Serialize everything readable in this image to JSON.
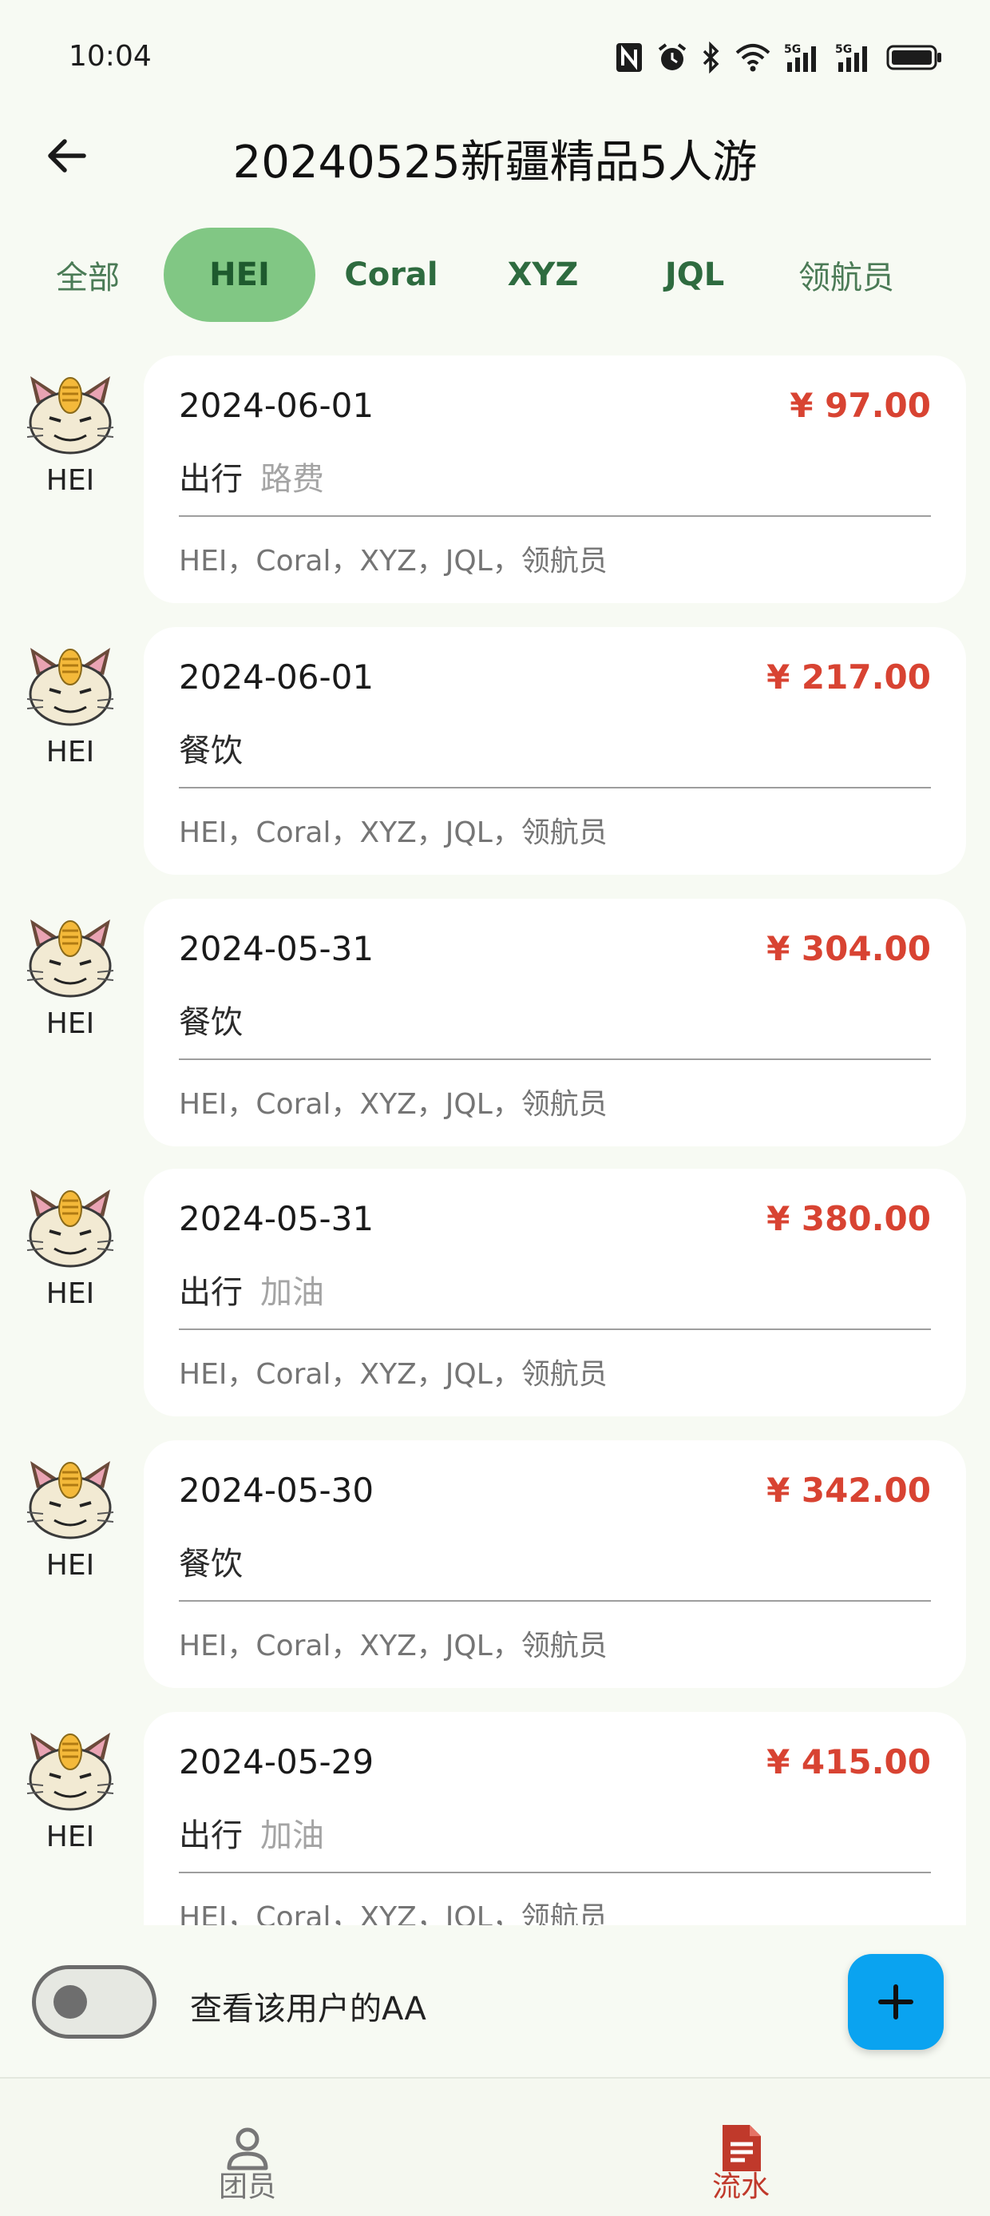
{
  "status_bar": {
    "time": "10:04"
  },
  "header": {
    "title": "20240525新疆精品5人游"
  },
  "tabs": [
    {
      "label": "全部",
      "active": false
    },
    {
      "label": "HEI",
      "active": true
    },
    {
      "label": "Coral",
      "active": false
    },
    {
      "label": "XYZ",
      "active": false
    },
    {
      "label": "JQL",
      "active": false
    },
    {
      "label": "领航员",
      "active": false
    }
  ],
  "records": [
    {
      "payer": "HEI",
      "date": "2024-06-01",
      "amount": "¥ 97.00",
      "category": "出行",
      "subcategory": "路费",
      "members": "HEI，Coral，XYZ，JQL，领航员"
    },
    {
      "payer": "HEI",
      "date": "2024-06-01",
      "amount": "¥ 217.00",
      "category": "餐饮",
      "subcategory": "",
      "members": "HEI，Coral，XYZ，JQL，领航员"
    },
    {
      "payer": "HEI",
      "date": "2024-05-31",
      "amount": "¥ 304.00",
      "category": "餐饮",
      "subcategory": "",
      "members": "HEI，Coral，XYZ，JQL，领航员"
    },
    {
      "payer": "HEI",
      "date": "2024-05-31",
      "amount": "¥ 380.00",
      "category": "出行",
      "subcategory": "加油",
      "members": "HEI，Coral，XYZ，JQL，领航员"
    },
    {
      "payer": "HEI",
      "date": "2024-05-30",
      "amount": "¥ 342.00",
      "category": "餐饮",
      "subcategory": "",
      "members": "HEI，Coral，XYZ，JQL，领航员"
    },
    {
      "payer": "HEI",
      "date": "2024-05-29",
      "amount": "¥ 415.00",
      "category": "出行",
      "subcategory": "加油",
      "members": "HEI，Coral，XYZ，JQL，领航员"
    }
  ],
  "toggle": {
    "label": "查看该用户的AA",
    "on": false
  },
  "bottom_nav": {
    "members_label": "团员",
    "flow_label": "流水"
  },
  "colors": {
    "accent": "#81c784",
    "amount": "#d84332",
    "fab": "#0aa3f0",
    "nav_active": "#c0392b"
  }
}
